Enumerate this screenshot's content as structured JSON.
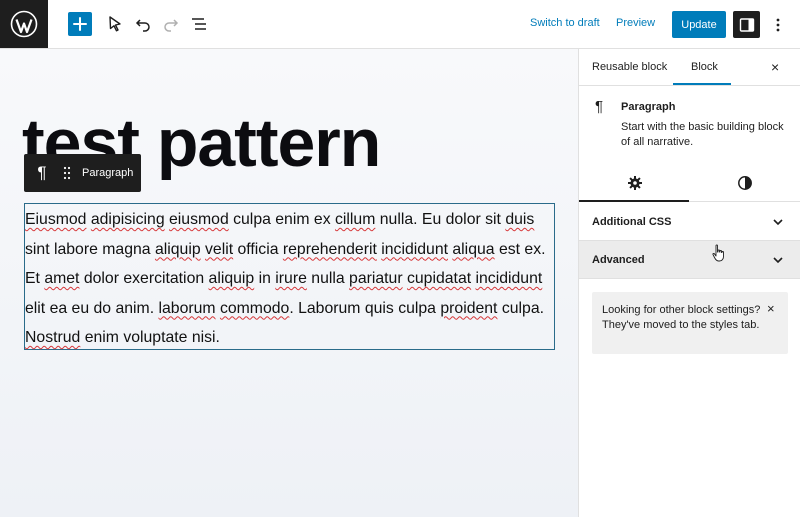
{
  "header": {
    "switch_draft": "Switch to draft",
    "preview": "Preview",
    "update": "Update",
    "icons": [
      "wordpress-logo",
      "plus-icon",
      "select-tool-icon",
      "undo-icon",
      "redo-icon",
      "list-view-icon",
      "sidebar-toggle-icon",
      "more-vertical-icon"
    ]
  },
  "editor": {
    "title": "test pattern",
    "block_toolbar": {
      "label": "Paragraph"
    },
    "paragraph": [
      {
        "t": "Eiusmod",
        "s": true
      },
      {
        "t": " "
      },
      {
        "t": "adipisicing",
        "s": true
      },
      {
        "t": " "
      },
      {
        "t": "eiusmod",
        "s": true
      },
      {
        "t": " culpa enim ex "
      },
      {
        "t": "cillum",
        "s": true
      },
      {
        "t": " nulla. Eu dolor sit "
      },
      {
        "t": "duis",
        "s": true
      },
      {
        "t": " sint labore magna "
      },
      {
        "t": "aliquip",
        "s": true
      },
      {
        "t": " "
      },
      {
        "t": "velit",
        "s": true
      },
      {
        "t": " officia "
      },
      {
        "t": "reprehenderit",
        "s": true
      },
      {
        "t": " "
      },
      {
        "t": "incididunt",
        "s": true
      },
      {
        "t": " "
      },
      {
        "t": "aliqua",
        "s": true
      },
      {
        "t": " est ex. Et "
      },
      {
        "t": "amet",
        "s": true
      },
      {
        "t": " dolor exercitation "
      },
      {
        "t": "aliquip",
        "s": true
      },
      {
        "t": " in "
      },
      {
        "t": "irure",
        "s": true
      },
      {
        "t": " nulla "
      },
      {
        "t": "pariatur",
        "s": true
      },
      {
        "t": " "
      },
      {
        "t": "cupidatat",
        "s": true
      },
      {
        "t": " "
      },
      {
        "t": "incididunt",
        "s": true
      },
      {
        "t": " elit ea eu do anim. "
      },
      {
        "t": "laborum",
        "s": true
      },
      {
        "t": " "
      },
      {
        "t": "commodo",
        "s": true
      },
      {
        "t": ". Laborum quis culpa "
      },
      {
        "t": "proident",
        "s": true
      },
      {
        "t": " culpa. "
      },
      {
        "t": "Nostrud",
        "s": true
      },
      {
        "t": " enim voluptate nisi."
      }
    ]
  },
  "sidebar": {
    "tabs": [
      "Reusable block",
      "Block"
    ],
    "active_tab": "Block",
    "close": "×",
    "block_card": {
      "title": "Paragraph",
      "description": "Start with the basic building block of all narrative."
    },
    "panels": [
      "Additional CSS",
      "Advanced"
    ],
    "notice": {
      "text": "Looking for other block settings? They've moved to the styles tab.",
      "close": "×"
    }
  },
  "colors": {
    "accent": "#007cba",
    "dark": "#1e1e1e",
    "spellcheck": "#d63638"
  }
}
